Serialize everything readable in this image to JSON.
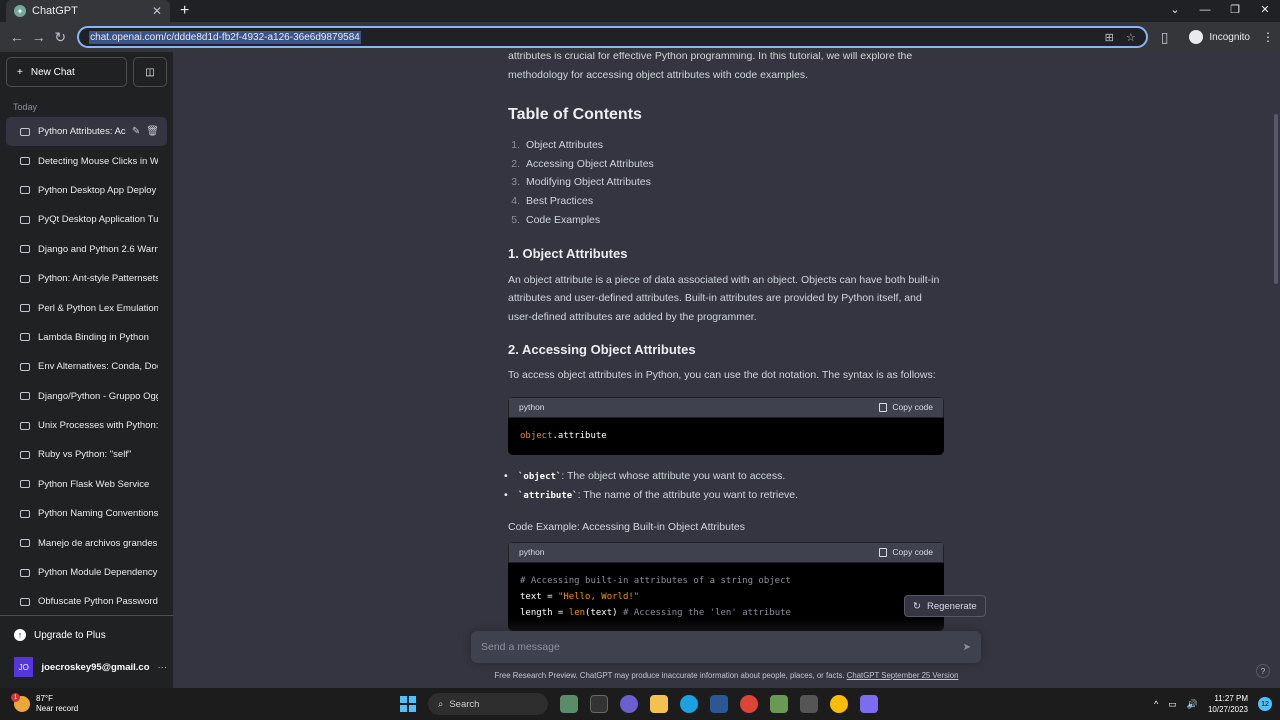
{
  "browser": {
    "tab_title": "ChatGPT",
    "url": "chat.openai.com/c/ddde8d1d-fb2f-4932-a126-36e6d9879584",
    "incognito_label": "Incognito"
  },
  "sidebar": {
    "new_chat_label": "New Chat",
    "section_today": "Today",
    "conversations": [
      "Python Attributes: Ac",
      "Detecting Mouse Clicks in W",
      "Python Desktop App Deploy",
      "PyQt Desktop Application Tu",
      "Django and Python 2.6 Warni",
      "Python: Ant-style Patternsets",
      "Perl & Python Lex Emulation",
      "Lambda Binding in Python",
      "Env Alternatives: Conda, Doc",
      "Django/Python - Gruppo Ogg",
      "Unix Processes with Python:",
      "Ruby vs Python: \"self\"",
      "Python Flask Web Service",
      "Python Naming Conventions",
      "Manejo de archivos grandes",
      "Python Module Dependency",
      "Obfuscate Python Password"
    ],
    "upgrade_label": "Upgrade to Plus",
    "user_initials": "JO",
    "user_email": "joecroskey95@gmail.co"
  },
  "content": {
    "intro_line1": "attributes is crucial for effective Python programming. In this tutorial, we will explore the",
    "intro_line2": "methodology for accessing object attributes with code examples.",
    "toc_heading": "Table of Contents",
    "toc": [
      {
        "num": "1.",
        "text": "Object Attributes"
      },
      {
        "num": "2.",
        "text": "Accessing Object Attributes"
      },
      {
        "num": "3.",
        "text": "Modifying Object Attributes"
      },
      {
        "num": "4.",
        "text": "Best Practices"
      },
      {
        "num": "5.",
        "text": "Code Examples"
      }
    ],
    "section1_heading": "1. Object Attributes",
    "section1_text": "An object attribute is a piece of data associated with an object. Objects can have both built-in attributes and user-defined attributes. Built-in attributes are provided by Python itself, and user-defined attributes are added by the programmer.",
    "section2_heading": "2. Accessing Object Attributes",
    "section2_text": "To access object attributes in Python, you can use the dot notation. The syntax is as follows:",
    "code1_lang": "python",
    "copy_label": "Copy code",
    "code1_object": "object",
    "code1_rest": ".attribute",
    "bullet1_code": "`object`",
    "bullet1_text": ": The object whose attribute you want to access.",
    "bullet2_code": "`attribute`",
    "bullet2_text": ": The name of the attribute you want to retrieve.",
    "example_heading": "Code Example: Accessing Built-in Object Attributes",
    "code2_lang": "python",
    "code2_line1": "# Accessing built-in attributes of a string object",
    "code2_line2_var": "text = ",
    "code2_line2_str": "\"Hello, World!\"",
    "code2_line3_var": "length = ",
    "code2_line3_fn": "len",
    "code2_line3_args": "(text)  ",
    "code2_line3_comment": "# Accessing the 'len' attribute"
  },
  "composer": {
    "regenerate_label": "Regenerate",
    "placeholder": "Send a message",
    "disclaimer_text": "Free Research Preview. ChatGPT may produce inaccurate information about people, places, or facts. ",
    "disclaimer_link": "ChatGPT September 25 Version"
  },
  "taskbar": {
    "temperature": "87°F",
    "weather_note": "Near record",
    "weather_badge": "1",
    "search_label": "Search",
    "time": "11:27 PM",
    "date": "10/27/2023",
    "notification_count": "12"
  }
}
